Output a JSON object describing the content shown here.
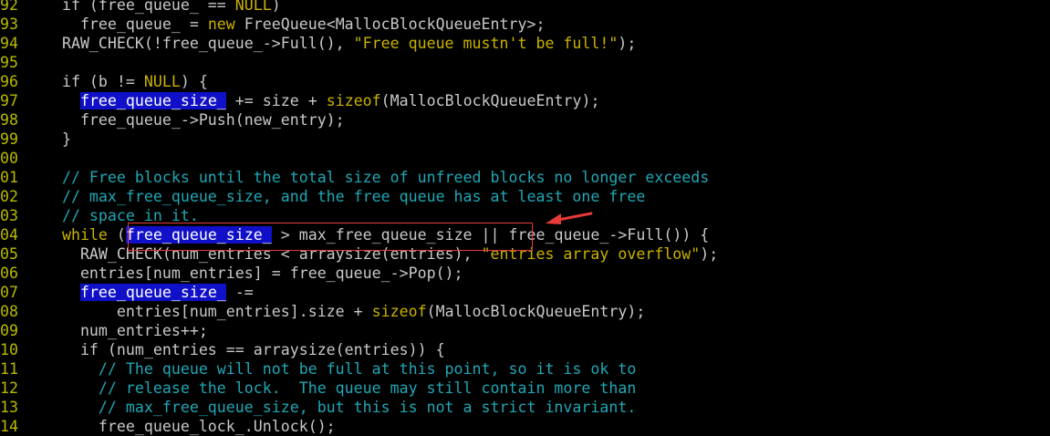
{
  "lines": [
    {
      "num": "92",
      "tokens": [
        {
          "t": "    if (free_queue_ == ",
          "c": "code"
        },
        {
          "t": "NULL",
          "c": "kw"
        },
        {
          "t": ")",
          "c": "code"
        }
      ]
    },
    {
      "num": "93",
      "tokens": [
        {
          "t": "      free_queue_ = ",
          "c": "code"
        },
        {
          "t": "new",
          "c": "kw"
        },
        {
          "t": " FreeQueue<MallocBlockQueueEntry>;",
          "c": "code"
        }
      ]
    },
    {
      "num": "94",
      "tokens": [
        {
          "t": "    RAW_CHECK(!free_queue_->Full(), ",
          "c": "code"
        },
        {
          "t": "\"Free queue mustn't be full!\"",
          "c": "str"
        },
        {
          "t": ");",
          "c": "code"
        }
      ]
    },
    {
      "num": "95",
      "tokens": []
    },
    {
      "num": "96",
      "tokens": [
        {
          "t": "    if (b != ",
          "c": "code"
        },
        {
          "t": "NULL",
          "c": "kw"
        },
        {
          "t": ") {",
          "c": "code"
        }
      ]
    },
    {
      "num": "97",
      "tokens": [
        {
          "t": "      ",
          "c": "code"
        },
        {
          "t": "free_queue_size_",
          "c": "hl"
        },
        {
          "t": " += size + ",
          "c": "code"
        },
        {
          "t": "sizeof",
          "c": "kw"
        },
        {
          "t": "(MallocBlockQueueEntry);",
          "c": "code"
        }
      ]
    },
    {
      "num": "98",
      "tokens": [
        {
          "t": "      free_queue_->Push(new_entry);",
          "c": "code"
        }
      ]
    },
    {
      "num": "99",
      "tokens": [
        {
          "t": "    }",
          "c": "code"
        }
      ]
    },
    {
      "num": "00",
      "tokens": []
    },
    {
      "num": "01",
      "tokens": [
        {
          "t": "    // Free blocks until the total size of unfreed blocks no longer exceeds",
          "c": "cmt"
        }
      ]
    },
    {
      "num": "02",
      "tokens": [
        {
          "t": "    // max_free_queue_size, and the free queue has at least one free",
          "c": "cmt"
        }
      ]
    },
    {
      "num": "03",
      "tokens": [
        {
          "t": "    // space in it.",
          "c": "cmt"
        }
      ]
    },
    {
      "num": "04",
      "tokens": [
        {
          "t": "    while",
          "c": "kw"
        },
        {
          "t": " (",
          "c": "code"
        },
        {
          "t": "free_queue_size_",
          "c": "hl"
        },
        {
          "t": " > max_free_queue_size || free_queue_->Full()) {",
          "c": "code"
        }
      ]
    },
    {
      "num": "05",
      "tokens": [
        {
          "t": "      RAW_CHECK(num_entries < arraysize(entries), ",
          "c": "code"
        },
        {
          "t": "\"entries array overflow\"",
          "c": "str"
        },
        {
          "t": ");",
          "c": "code"
        }
      ]
    },
    {
      "num": "06",
      "tokens": [
        {
          "t": "      entries[num_entries] = free_queue_->Pop();",
          "c": "code"
        }
      ]
    },
    {
      "num": "07",
      "tokens": [
        {
          "t": "      ",
          "c": "code"
        },
        {
          "t": "free_queue_size_",
          "c": "hl"
        },
        {
          "t": " -=",
          "c": "code"
        }
      ]
    },
    {
      "num": "08",
      "tokens": [
        {
          "t": "          entries[num_entries].size + ",
          "c": "code"
        },
        {
          "t": "sizeof",
          "c": "kw"
        },
        {
          "t": "(MallocBlockQueueEntry);",
          "c": "code"
        }
      ]
    },
    {
      "num": "09",
      "tokens": [
        {
          "t": "      num_entries++;",
          "c": "code"
        }
      ]
    },
    {
      "num": "10",
      "tokens": [
        {
          "t": "      if (num_entries == arraysize(entries)) {",
          "c": "code"
        }
      ]
    },
    {
      "num": "11",
      "tokens": [
        {
          "t": "        // The queue will not be full at this point, so it is ok to",
          "c": "cmt"
        }
      ]
    },
    {
      "num": "12",
      "tokens": [
        {
          "t": "        // release the lock.  The queue may still contain more than",
          "c": "cmt"
        }
      ]
    },
    {
      "num": "13",
      "tokens": [
        {
          "t": "        // max_free_queue_size, but this is not a strict invariant.",
          "c": "cmt"
        }
      ]
    },
    {
      "num": "14",
      "tokens": [
        {
          "t": "        free_queue_lock_.Unlock();",
          "c": "code"
        }
      ]
    }
  ],
  "colors": {
    "background": "#000000",
    "line_number": "#b9b900",
    "keyword": "#c9b200",
    "comment": "#1fa7b5",
    "highlight_bg": "#1010c8",
    "annotation_red": "#e83a3a"
  },
  "annotation": {
    "icon": "arrow-annotation-icon",
    "box": "highlight-box-annotation"
  }
}
